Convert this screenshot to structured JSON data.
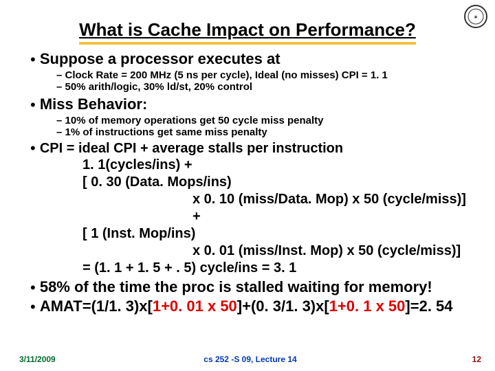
{
  "title": "What is Cache Impact on Performance?",
  "bullets": {
    "suppose": "Suppose a processor executes at",
    "suppose_sub1": "Clock Rate = 200 MHz (5 ns per cycle), Ideal (no misses) CPI = 1. 1",
    "suppose_sub2": "50% arith/logic, 30% ld/st, 20% control",
    "miss": "Miss Behavior:",
    "miss_sub1": "10% of memory operations get 50 cycle miss penalty",
    "miss_sub2": "1% of instructions get same miss penalty",
    "cpi_head": "CPI   = ideal CPI + average stalls per instruction",
    "cpi_l1": "1. 1(cycles/ins)  +",
    "cpi_l2": "[ 0. 30 (Data. Mops/ins)",
    "cpi_l3": "x 0. 10 (miss/Data. Mop) x 50 (cycle/miss)] +",
    "cpi_l4": "[ 1 (Inst. Mop/ins)",
    "cpi_l5": "x 0. 01 (miss/Inst. Mop) x 50 (cycle/miss)]",
    "cpi_l6": "= (1. 1 +  1. 5 + . 5) cycle/ins = 3. 1",
    "stall": "58% of the time the proc is stalled waiting for memory!",
    "amat_pre": "AMAT=(1/1. 3)x[",
    "amat_r1": "1+0. 01 x 50",
    "amat_mid": "]+(0. 3/1. 3)x[",
    "amat_r2": "1+0. 1 x 50",
    "amat_post": "]=2. 54"
  },
  "footer": {
    "date": "3/11/2009",
    "center": "cs 252 -S 09, Lecture 14",
    "page": "12"
  }
}
